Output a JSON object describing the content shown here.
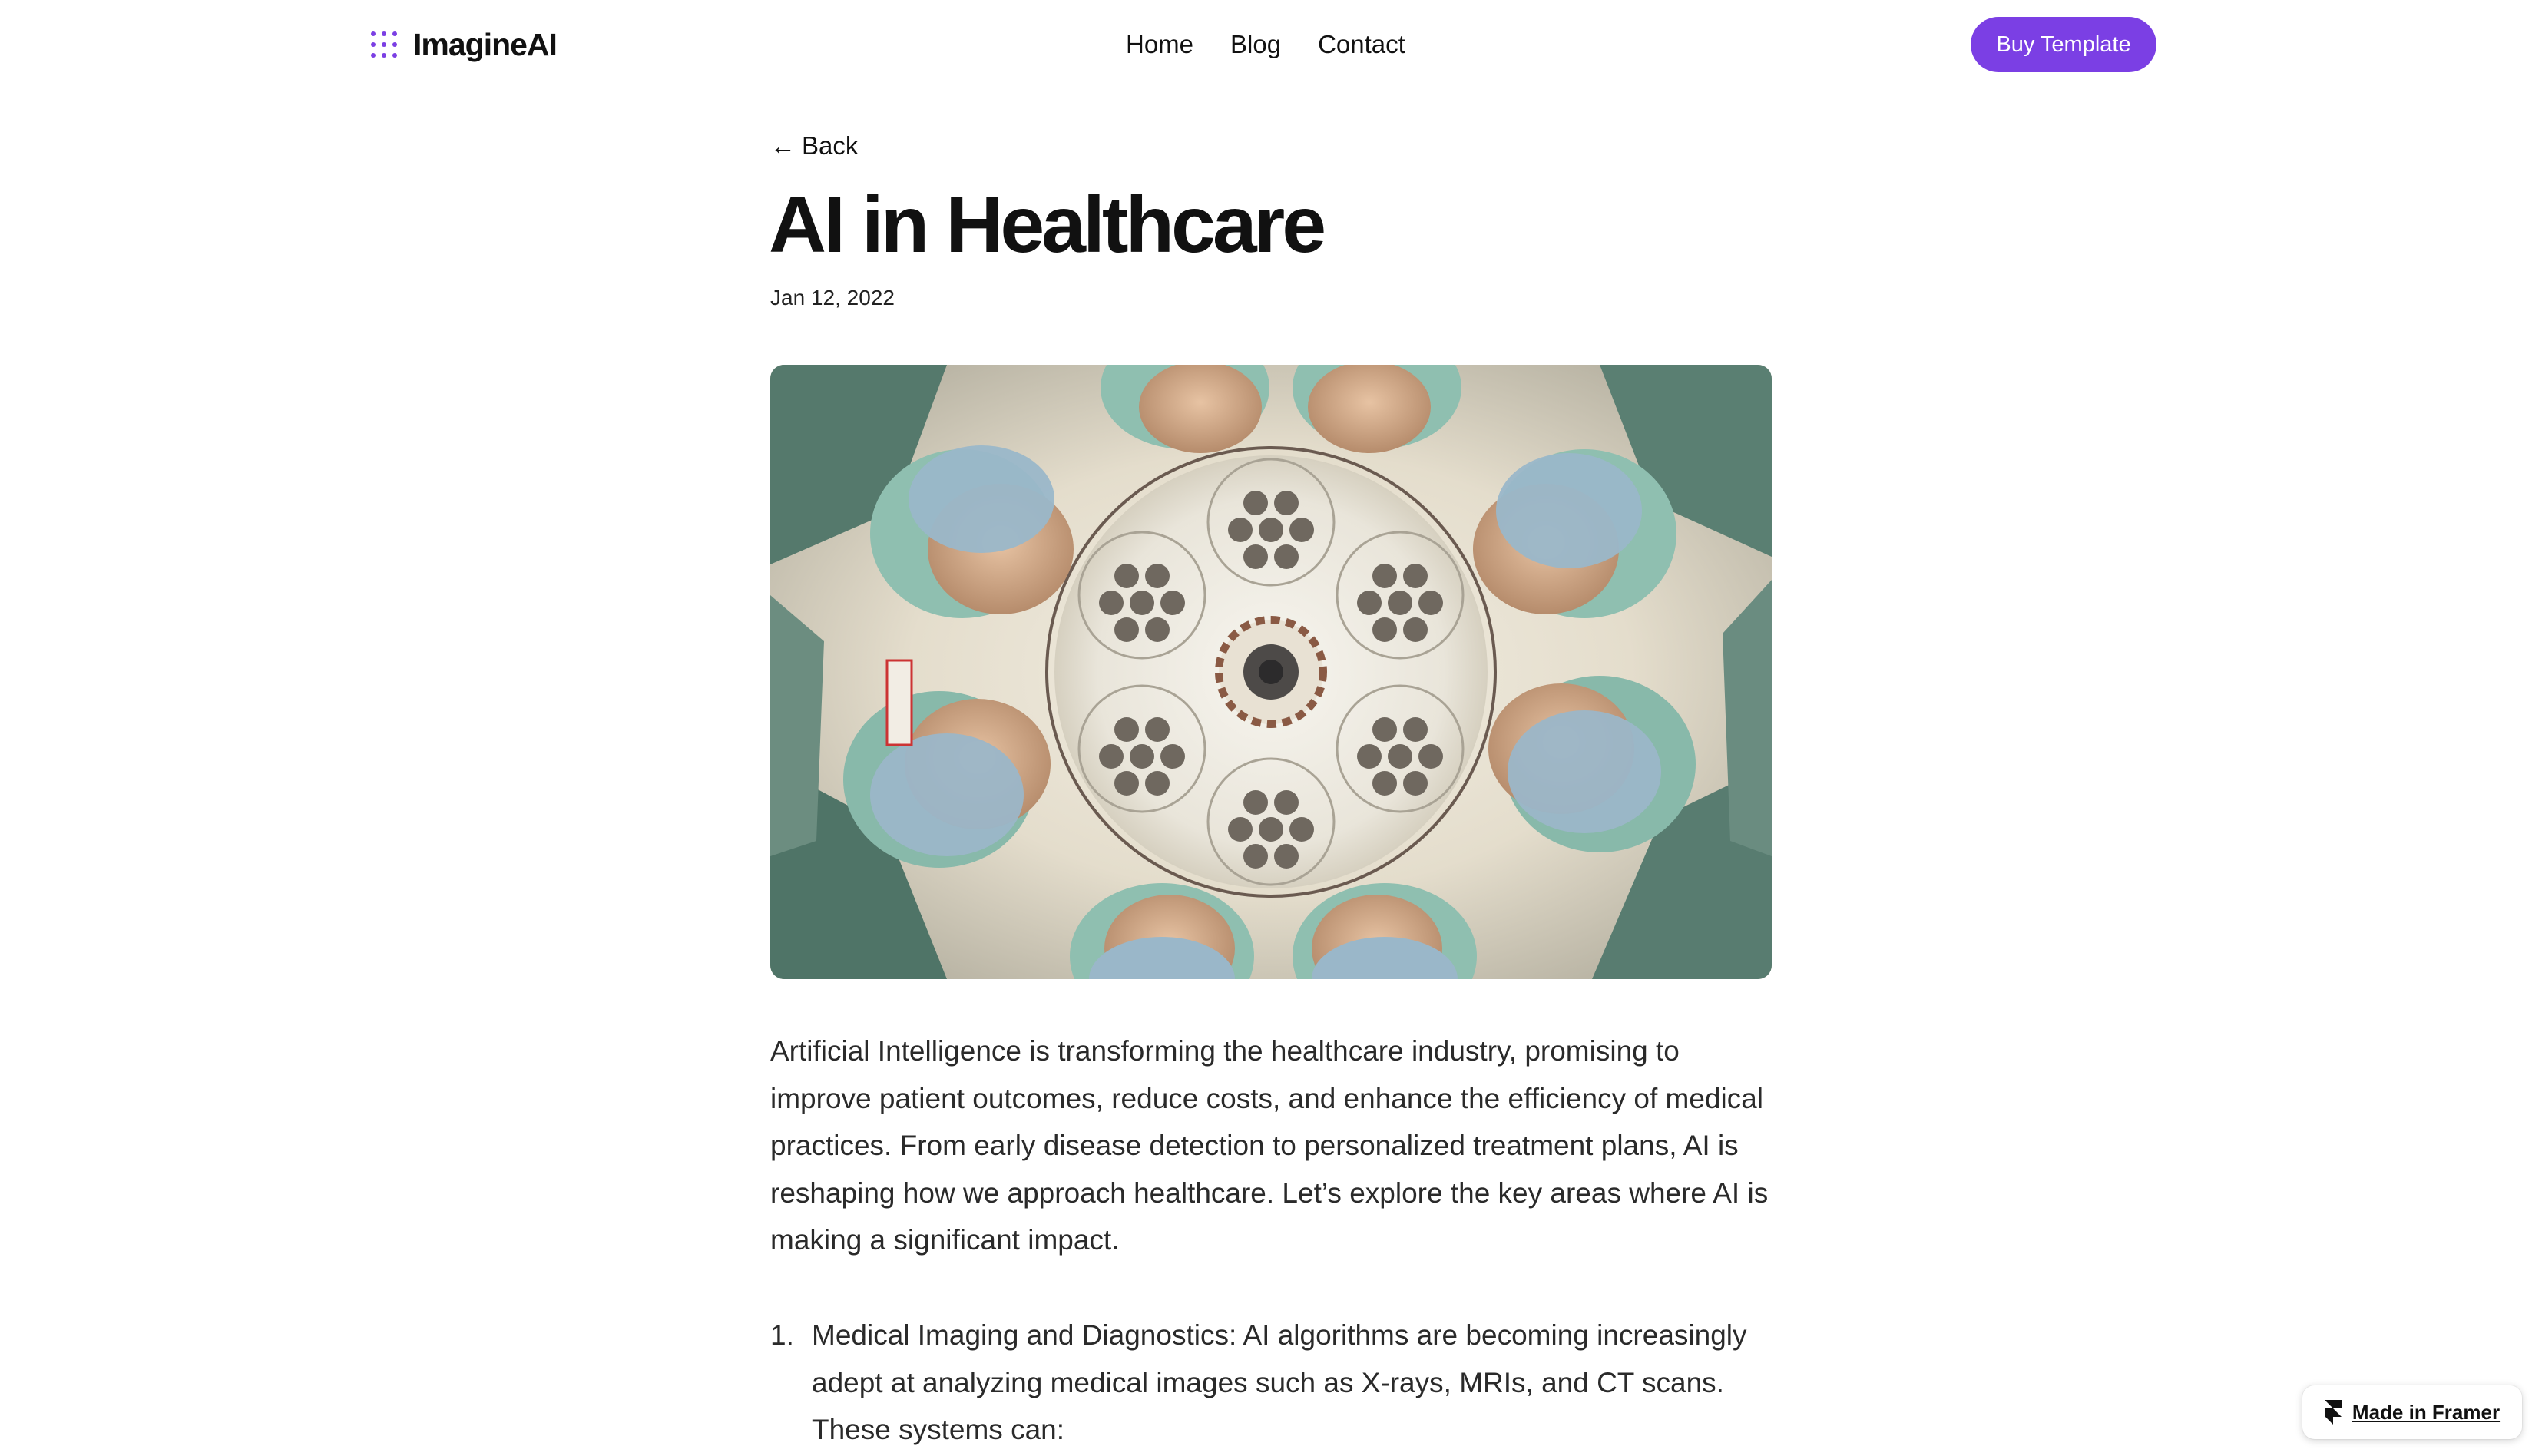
{
  "header": {
    "brand_name": "ImagineAI",
    "brand_icon": "dots-grid-icon",
    "nav": [
      {
        "label": "Home"
      },
      {
        "label": "Blog"
      },
      {
        "label": "Contact"
      }
    ],
    "cta_label": "Buy Template"
  },
  "article": {
    "back_arrow": "←",
    "back_label": "Back",
    "title": "AI in Healthcare",
    "date": "Jan 12, 2022",
    "hero_image": "surgeons-looking-down-photo",
    "intro": "Artificial Intelligence is transforming the healthcare industry, promising to improve patient outcomes, reduce costs, and enhance the efficiency of medical practices. From early disease detection to personalized treatment plans, AI is reshaping how we approach healthcare. Let’s explore the key areas where AI is making a significant impact.",
    "list": [
      {
        "number": "1.",
        "text": "Medical Imaging and Diagnostics: AI algorithms are becoming increasingly adept at analyzing medical images such as X-rays, MRIs, and CT scans. These systems can:"
      }
    ]
  },
  "badge": {
    "label": "Made in Framer",
    "icon": "framer-logo-icon"
  },
  "colors": {
    "accent": "#7b3fe4",
    "text": "#111111",
    "body_text": "#2a2a2a"
  }
}
